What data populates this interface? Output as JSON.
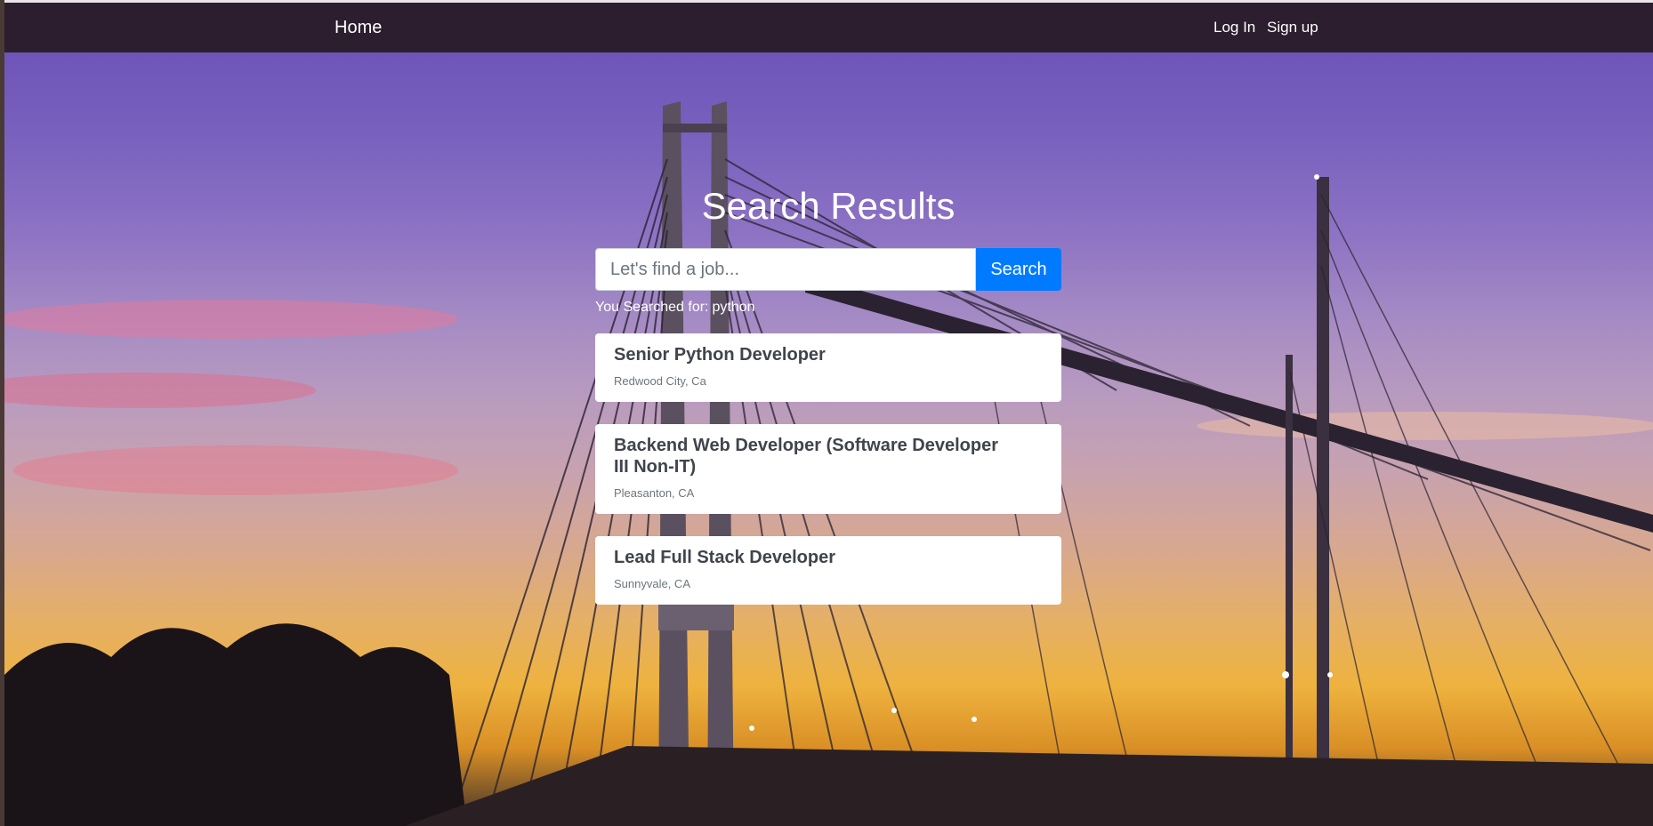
{
  "navbar": {
    "home_label": "Home",
    "login_label": "Log In",
    "signup_label": "Sign up"
  },
  "main": {
    "title": "Search Results",
    "search": {
      "placeholder": "Let's find a job...",
      "value": "",
      "button_label": "Search"
    },
    "searched_for_label": "You Searched for:",
    "searched_for_query": "python",
    "results": [
      {
        "title": "Senior Python Developer",
        "location": "Redwood City, Ca"
      },
      {
        "title": "Backend Web Developer (Software Developer III Non-IT)",
        "location": "Pleasanton, CA"
      },
      {
        "title": "Lead Full Stack Developer",
        "location": "Sunnyvale, CA"
      }
    ]
  },
  "colors": {
    "navbar": "#2c1e2e",
    "search_button": "#007bff",
    "card_title": "#40444c"
  }
}
